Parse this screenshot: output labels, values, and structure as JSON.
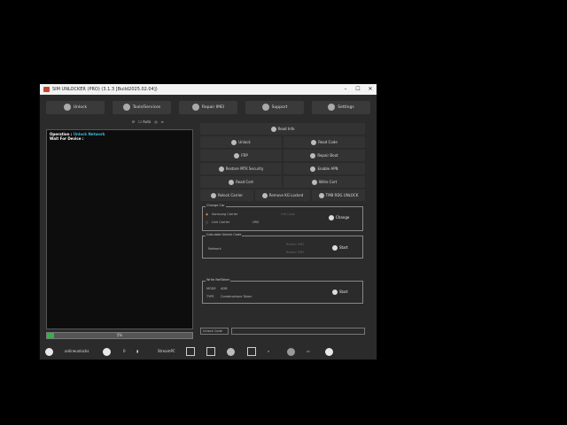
{
  "window": {
    "title": "SIM UNLOCKER (PRO) (3.1.3 [Build2025.02.04])"
  },
  "nav": {
    "unlock": "Unlock",
    "tools": "Tools/Services",
    "repair_imei": "Repair IMEI",
    "support": "Support",
    "settings": "Settings"
  },
  "tools": {
    "auto": "Auto"
  },
  "console": {
    "operation_label": "Operation :",
    "operation_value": "Unlock Network",
    "wait": "Wait For Device :"
  },
  "progress": {
    "percent": 5,
    "label": "5%"
  },
  "actions": {
    "read_info": "Read Info",
    "unlock": "Unlock",
    "read_code": "Read Code",
    "frp": "FRP",
    "repair_boot": "Repair Boot",
    "restore_mtk": "Restore MTK Security",
    "enable_apn": "Enable APN",
    "read_cert": "Read Cert",
    "write_cert": "Write Cert",
    "relock_carrier": "Relock Carrier",
    "remove_kg": "Remove KG Locked",
    "tmb_unlock": "TMB RDG UNLOCK"
  },
  "change_car": {
    "legend": "Change Car",
    "opt1": "Samsung Carrier",
    "opt2": "Link Carrier",
    "old_code": "Old Code",
    "tag": "URS",
    "button": "Change"
  },
  "calc": {
    "legend": "Calculate Unlock Code",
    "network": "Network",
    "f1": "Bootro IMEI",
    "f2": "Bootro IMEI",
    "button": "Start"
  },
  "write_token": {
    "legend": "Write NetToken",
    "mode_label": "MODE",
    "mode_value": "ADB",
    "type_label": "TYPE",
    "type_value": "Combinatione Token",
    "button": "Start"
  },
  "status": {
    "unlock_code": "Unlock Code"
  },
  "bottom": {
    "user": "onlineunlocks",
    "count": "0",
    "device": "StreamPC"
  },
  "colors": {
    "accent": "#3fb8e0",
    "progress": "#2fb34a",
    "background": "#2b2b2b"
  }
}
